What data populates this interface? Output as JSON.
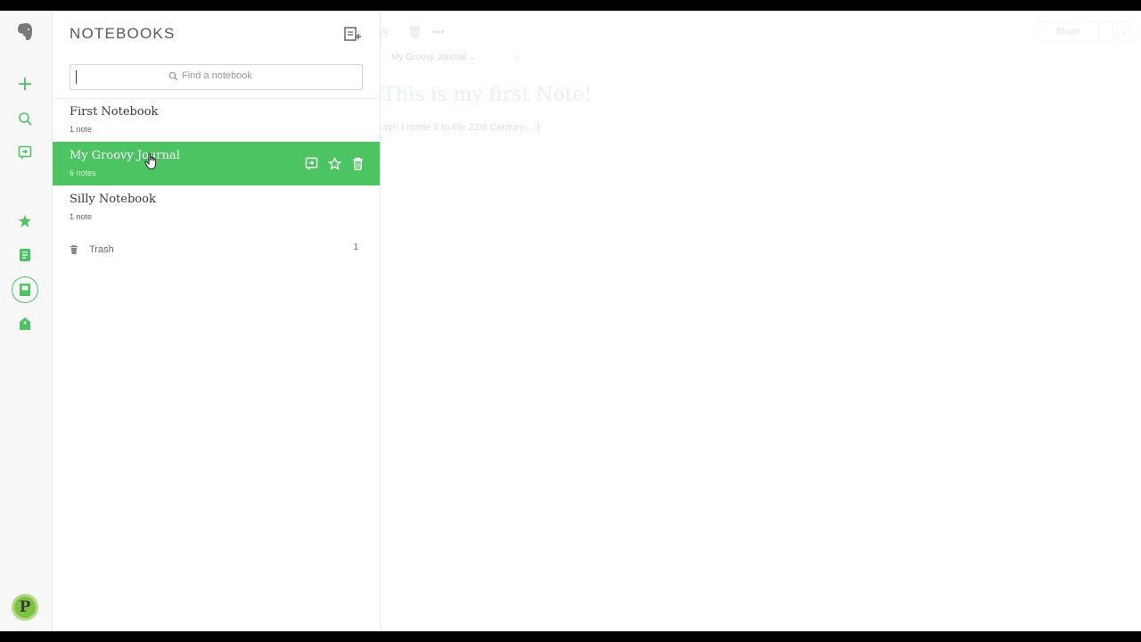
{
  "sidebar": {
    "icons": [
      "elephant-logo-icon",
      "plus-icon",
      "search-icon",
      "work-chat-icon",
      "star-icon",
      "note-icon",
      "notebook-icon",
      "tag-icon"
    ],
    "avatar_letter": "P"
  },
  "notebooks_panel": {
    "title": "NOTEBOOKS",
    "search_placeholder": "Find a notebook",
    "items": [
      {
        "name": "First Notebook",
        "count": "1 note"
      },
      {
        "name": "My Groovy Journal",
        "count": "6 notes"
      },
      {
        "name": "Silly Notebook",
        "count": "1 note"
      }
    ],
    "trash": {
      "label": "Trash",
      "count": "1"
    }
  },
  "note": {
    "notebook": "My Groovy Journal",
    "title": "This is my first Note!",
    "body": "ay!! I made it to the 21st Century... :)",
    "share_label": "Share"
  },
  "colors": {
    "accent": "#4cc462",
    "text": "#3a3a3a"
  }
}
